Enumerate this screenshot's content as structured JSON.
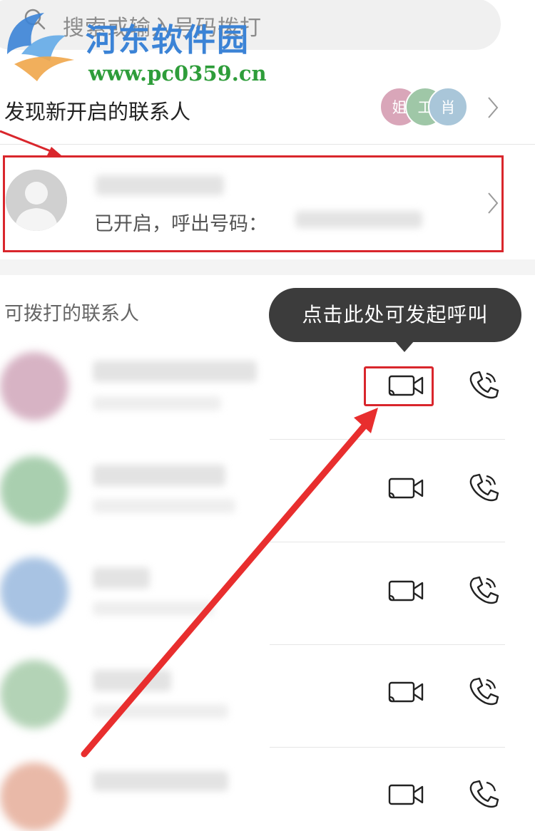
{
  "search": {
    "placeholder": "搜索或输入号码拨打"
  },
  "watermark": {
    "title": "河东软件园",
    "url": "www.pc0359.cn"
  },
  "discover": {
    "label": "发现新开启的联系人",
    "avatars": [
      {
        "char": "姐",
        "color": "#d9a6b9"
      },
      {
        "char": "工",
        "color": "#9fc7a7"
      },
      {
        "char": "肖",
        "color": "#a9c6d9"
      }
    ]
  },
  "self_card": {
    "status": "已开启，呼出号码："
  },
  "callable": {
    "label": "可拨打的联系人"
  },
  "tooltip": {
    "text": "点击此处可发起呼叫"
  },
  "contacts": [
    {
      "avatar_color": "#d7b3c4"
    },
    {
      "avatar_color": "#a9cfaf"
    },
    {
      "avatar_color": "#a8c3e3"
    },
    {
      "avatar_color": "#b3d3b6"
    },
    {
      "avatar_color": "#e9b9a8"
    }
  ],
  "icons": {
    "video_call": "video-call-icon",
    "voice_call": "phone-call-icon",
    "chevron": "chevron-right-icon"
  },
  "colors": {
    "annotation_red": "#d9262c",
    "tooltip_bg": "#3c3c3c",
    "watermark_blue": "#3b83d6",
    "watermark_green": "#2e9d3a"
  }
}
